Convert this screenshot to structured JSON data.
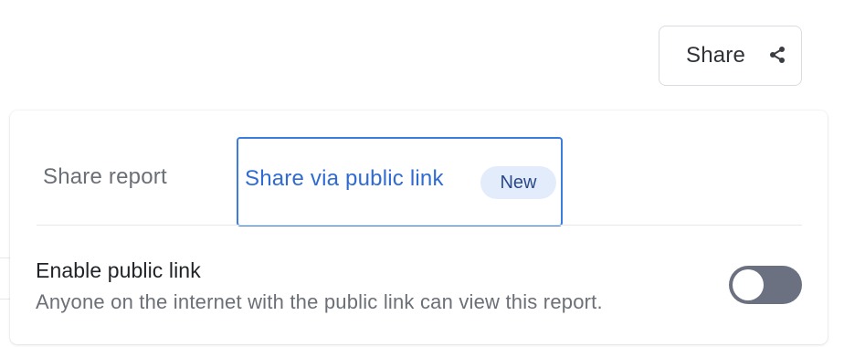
{
  "header": {
    "share_button": {
      "label": "Share",
      "icon": "share-icon"
    }
  },
  "popover": {
    "tabs": [
      {
        "label": "Share report",
        "active": false
      },
      {
        "label": "Share via public link",
        "active": true,
        "badge": "New"
      }
    ],
    "setting": {
      "title": "Enable public link",
      "description": "Anyone on the internet with the public link can view this report.",
      "enabled": false
    }
  },
  "colors": {
    "accent": "#3b7ddd",
    "active_tab_text": "#2f6bd3",
    "badge_bg": "#e3ecfb",
    "toggle_off": "#6b7180"
  }
}
